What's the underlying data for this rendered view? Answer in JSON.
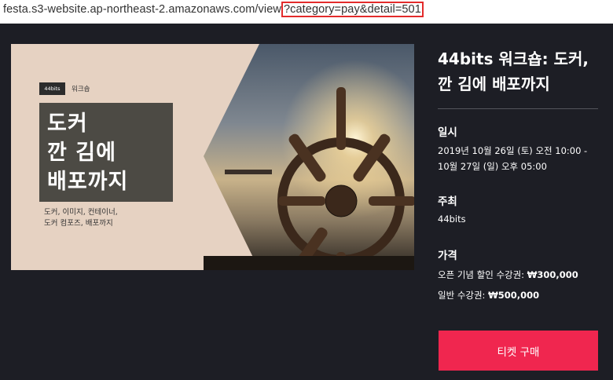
{
  "browser": {
    "url_base": "festa.s3-website.ap-northeast-2.amazonaws.com/view",
    "url_query": "?category=pay&detail=501"
  },
  "banner": {
    "brand_logo": "44bits",
    "brand_tag": "워크숍",
    "title_lines": [
      "도커",
      "깐 김에",
      "배포까지"
    ],
    "subtitle_lines": [
      "도커, 이미지, 컨테이너,",
      "도커 컴포즈, 배포까지"
    ]
  },
  "event": {
    "title": "44bits 워크숍: 도커, 깐 김에 배포까지",
    "date_heading": "일시",
    "date_line1": "2019년 10월 26일 (토) 오전 10:00 -",
    "date_line2": "10월 27일 (일) 오후 05:00",
    "host_heading": "주최",
    "host": "44bits",
    "price_heading": "가격",
    "price1_label": "오픈 기념 할인 수강권: ",
    "price1_value": "₩300,000",
    "price2_label": "일반 수강권: ",
    "price2_value": "₩500,000",
    "buy_button": "티켓 구매"
  },
  "colors": {
    "background": "#1d1e25",
    "accent": "#f0264f",
    "banner_beige": "#e6d2c2",
    "title_box": "#4c4a44"
  }
}
